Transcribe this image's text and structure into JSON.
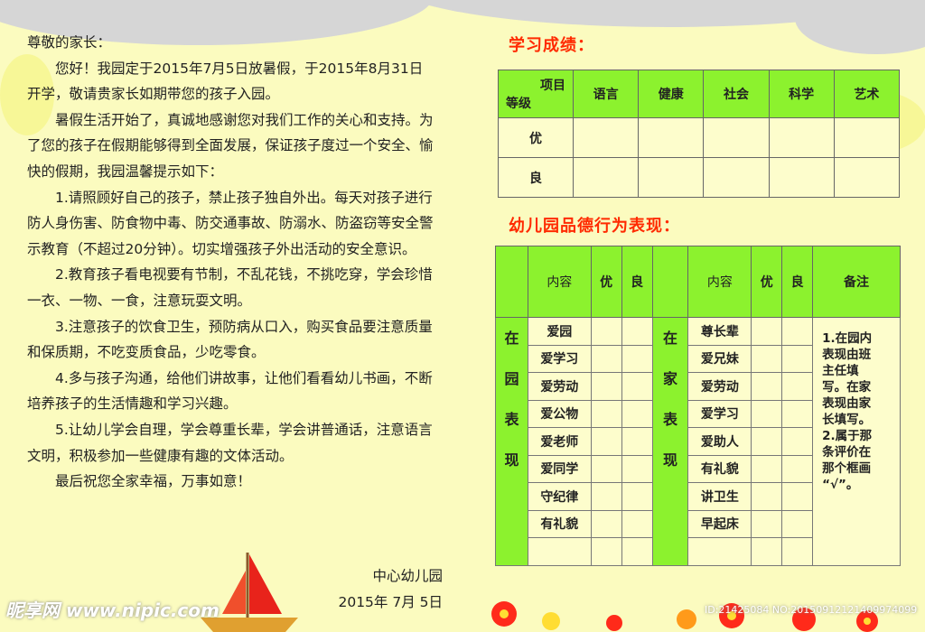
{
  "letter": {
    "greeting": "尊敬的家长：",
    "paragraphs": [
      "您好！我园定于2015年7月5日放暑假，于2015年8月31日开学，敬请贵家长如期带您的孩子入园。",
      "暑假生活开始了，真诚地感谢您对我们工作的关心和支持。为了您的孩子在假期能够得到全面发展，保证孩子度过一个安全、愉快的假期，我园温馨提示如下：",
      "1.请照顾好自己的孩子，禁止孩子独自外出。每天对孩子进行防人身伤害、防食物中毒、防交通事故、防溺水、防盗窃等安全警示教育（不超过20分钟）。切实增强孩子外出活动的安全意识。",
      "2.教育孩子看电视要有节制，不乱花钱，不挑吃穿，学会珍惜一衣、一物、一食，注意玩耍文明。",
      "3.注意孩子的饮食卫生，预防病从口入，购买食品要注意质量和保质期，不吃变质食品，少吃零食。",
      "4.多与孩子沟通，给他们讲故事，让他们看看幼儿书画，不断培养孩子的生活情趣和学习兴趣。",
      "5.让幼儿学会自理，学会尊重长辈，学会讲普通话，注意语言文明，积极参加一些健康有趣的文体活动。",
      "最后祝您全家幸福，万事如意！"
    ],
    "signature": "中心幼儿园",
    "date": "2015年 7月 5日"
  },
  "grades": {
    "heading": "学习成绩：",
    "corner_top": "项目",
    "corner_bottom": "等级",
    "subjects": [
      "语言",
      "健康",
      "社会",
      "科学",
      "艺术"
    ],
    "levels": [
      "优",
      "良"
    ]
  },
  "behavior": {
    "heading": "幼儿园品德行为表现：",
    "col_content": "内容",
    "col_excellent": "优",
    "col_good": "良",
    "col_note": "备注",
    "school_label": "在园表现",
    "home_label": "在家表现",
    "school_items": [
      "爱园",
      "爱学习",
      "爱劳动",
      "爱公物",
      "爱老师",
      "爱同学",
      "守纪律",
      "有礼貌"
    ],
    "home_items": [
      "尊长辈",
      "爱兄妹",
      "爱劳动",
      "爱学习",
      "爱助人",
      "有礼貌",
      "讲卫生",
      "早起床"
    ],
    "note_lines": [
      "1.在园内",
      "表现由班",
      "主任填",
      "写。在家",
      "表现由家",
      "长填写。",
      "2.属于那",
      "条评价在",
      "那个框画",
      "“√”。"
    ]
  },
  "watermark": {
    "logo": "昵享网 www.nipic.com",
    "id": "ID:21425084 NO:20150912121409974099"
  },
  "colors": {
    "header_green": "#8cf22e",
    "heading_red": "#ff2a00",
    "paper": "#fbfbbf"
  }
}
